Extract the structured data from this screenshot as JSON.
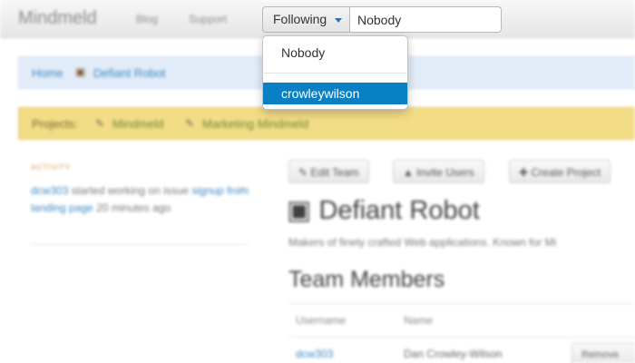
{
  "navbar": {
    "brand": "Mindmeld",
    "links": [
      "Blog",
      "Support"
    ]
  },
  "filter": {
    "button_label": "Following",
    "input_value": "Nobody",
    "options": [
      "Nobody",
      "crowleywilson"
    ],
    "selected_index": 1
  },
  "breadcrumb": {
    "home": "Home",
    "current": "Defiant Robot"
  },
  "projects": {
    "label": "Projects:",
    "items": [
      "Mindmeld",
      "Marketing Mindmeld"
    ]
  },
  "activity": {
    "heading": "ACTIVITY",
    "user": "dcw303",
    "action": " started working on issue ",
    "issue": "signup from landing page",
    "time": " 20 minutes ago",
    "close": "×"
  },
  "toolbar": {
    "edit_team": "Edit Team",
    "invite_users": "Invite Users",
    "create_project": "Create Project"
  },
  "team": {
    "title": "Defiant Robot",
    "description": "Makers of finely crafted Web applications. Known for Mi"
  },
  "members": {
    "title": "Team Members",
    "columns": [
      "Username",
      "Name"
    ],
    "rows": [
      {
        "username": "dcw303",
        "name": "Dan Crowley-Wilson",
        "action": "Remove"
      }
    ]
  }
}
